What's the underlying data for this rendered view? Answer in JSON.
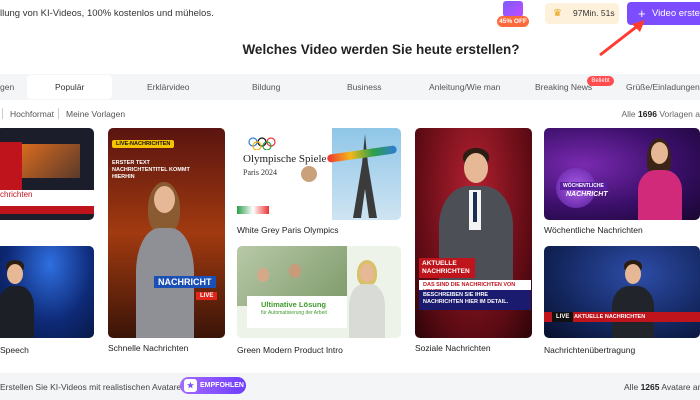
{
  "topbar": {
    "banner_text": "llung von KI-Videos, 100% kostenlos und mühelos.",
    "offer_badge": "45% OFF",
    "minutes_value": "97Min. 51s",
    "create_button": "Video erstellen",
    "colors": {
      "accent": "#7b4dff",
      "arrow": "#ff3b30",
      "offer": "#ff6a3d"
    }
  },
  "headline": "Welches Video werden Sie heute erstellen?",
  "categories": {
    "items": [
      {
        "label": "gen"
      },
      {
        "label": "Populär",
        "active": true
      },
      {
        "label": "Erklärvideo"
      },
      {
        "label": "Bildung"
      },
      {
        "label": "Business"
      },
      {
        "label": "Anleitung/Wie man"
      },
      {
        "label": "Breaking News",
        "badge": "Beliebt"
      },
      {
        "label": "Grüße/Einladungen"
      }
    ]
  },
  "filters": {
    "items": [
      "Hochformat",
      "Meine Vorlagen"
    ],
    "count_prefix": "Alle",
    "count_value": "1696",
    "count_suffix": "Vorlagen a"
  },
  "templates": [
    {
      "caption": "chrichten",
      "overlay": ""
    },
    {
      "caption": "Schnelle Nachrichten",
      "overlay_top": "LIVE-NACHRICHTEN",
      "overlay_mid": "ERSTER TEXT NACHRICHTENTITEL KOMMT HIERHIN",
      "overlay_main": "NACHRICHT",
      "overlay_live": "LIVE"
    },
    {
      "caption": "White Grey Paris Olympics",
      "title": "Olympische Spiele",
      "subtitle": "Paris 2024"
    },
    {
      "caption": "Soziale Nachrichten",
      "overlay_head": "AKTUELLE NACHRICHTEN",
      "overlay_line1": "DAS SIND DIE NACHRICHTEN VON HEUTE.",
      "overlay_line2": "BESCHREIBEN SIE IHRE NACHRICHTEN HIER IM DETAIL."
    },
    {
      "caption": "Wöchentliche Nachrichten",
      "overlay": "NACHRICHT",
      "overlay_small": "WÖCHENTLICHE"
    },
    {
      "caption": "Speech",
      "overlay": ""
    },
    {
      "caption": "Green Modern Product Intro",
      "title": "Ultimative Lösung",
      "subtitle": "für Automatisierung der Arbeit"
    },
    {
      "caption": "Nachrichtenübertragung",
      "overlay_live": "LIVE",
      "overlay_bar": "AKTUELLE NACHRICHTEN"
    }
  ],
  "bottombar": {
    "text": "Erstellen Sie KI-Videos mit realistischen Avataren",
    "badge": "EMPFOHLEN",
    "count_prefix": "Alle",
    "count_value": "1265",
    "count_suffix": "Avatare anz"
  },
  "icons": {
    "gift": "gift-icon",
    "crown": "crown-icon",
    "plus": "plus-icon",
    "arrow": "arrow-pointer-icon",
    "recommend": "thumbs-up-icon"
  }
}
